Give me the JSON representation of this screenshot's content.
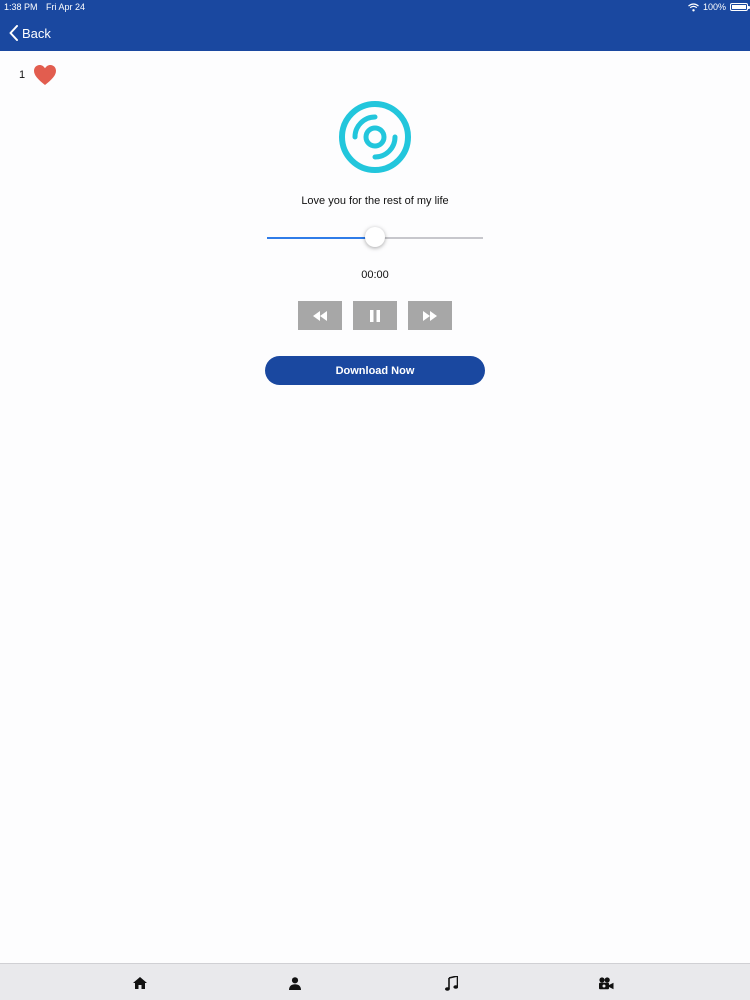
{
  "status_bar": {
    "time": "1:38 PM",
    "date": "Fri Apr 24",
    "battery": "100%"
  },
  "nav": {
    "back_label": "Back"
  },
  "like": {
    "count": "1",
    "icon": "heart-icon",
    "color": "#e25d4f"
  },
  "player": {
    "disc_icon": "disc-icon",
    "song_title": "Love you for the rest of my life",
    "progress_fraction": 0.5,
    "elapsed": "00:00",
    "controls": [
      "rewind-icon",
      "pause-icon",
      "fast-forward-icon"
    ],
    "download_label": "Download Now"
  },
  "tabbar": {
    "tabs": [
      "home-icon",
      "person-icon",
      "music-note-icon",
      "video-camera-icon"
    ]
  },
  "colors": {
    "header": "#1a48a0",
    "accent": "#2f7ce8",
    "disc": "#22c6dc",
    "control_bg": "#a7a7a7"
  }
}
